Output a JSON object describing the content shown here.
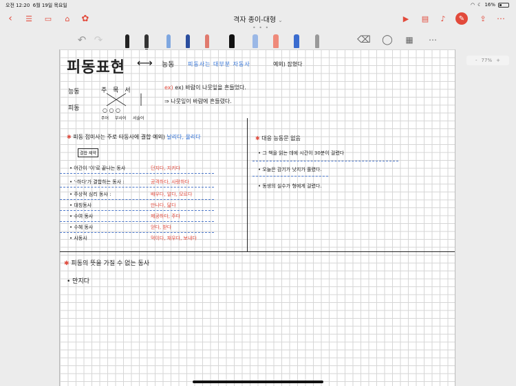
{
  "status": {
    "time": "오전 12:20",
    "date": "6월 19일 목요일",
    "battery": "16%"
  },
  "app": {
    "title": "격자 종이-대형"
  },
  "zoom": {
    "label": "77%"
  },
  "note": {
    "heading": "피동표현",
    "arrow": "⟷",
    "heading_active": "능동",
    "heading_note_blue": "피동사는 대부분 자동사",
    "heading_note_black": "예외) 잡혔다",
    "row_active_label": "능동",
    "row_passive_label": "피동",
    "active_chars": "주  목  서",
    "passive_chars": "○   ○    ○",
    "sub1": "주어",
    "sub2": "부사어",
    "sub3": "서술어",
    "example1": "ex) 바람이 나뭇잎을 흔들었다.",
    "example2": "⇒ 나뭇잎이 바람에 흔들렸다.",
    "left_section_title": "피동 접미사는 주로 타동사에 결합 예외)",
    "left_section_exceptions": "날리다, 울리다",
    "box_label": "결합 제약",
    "rules": [
      {
        "label": "• 어간이 '이'로 끝나는 동사",
        "examples": "던지다, 지키다"
      },
      {
        "label": "• '-하다'가 결합하는 동사 :",
        "examples": "공격하다, 사랑하다"
      },
      {
        "label": "• 주상적 심리 동사 :",
        "examples": "배우다, 알다, 모르다"
      },
      {
        "label": "• 대칭동사",
        "examples": "만나다, 닮다"
      },
      {
        "label": "• 수여 동사",
        "examples": "제공하다, 주다"
      },
      {
        "label": "• 수혜 동사",
        "examples": "얻다, 받다"
      },
      {
        "label": "• 사동사",
        "examples": "먹이다, 재우다, 보내다"
      }
    ],
    "right_section_title": "대응 능동문 없음",
    "right_items": [
      "• 그 책을 읽는 데에 시간이 30분이 걸렸다",
      "• 오늘은 감기가 낫지가 풀렸다.",
      "• 동생의 실수가 형에게 걸렸다."
    ],
    "bottom_title": "피동의 뜻을 가질 수 없는 동사",
    "bottom_item": "• 만지다"
  }
}
